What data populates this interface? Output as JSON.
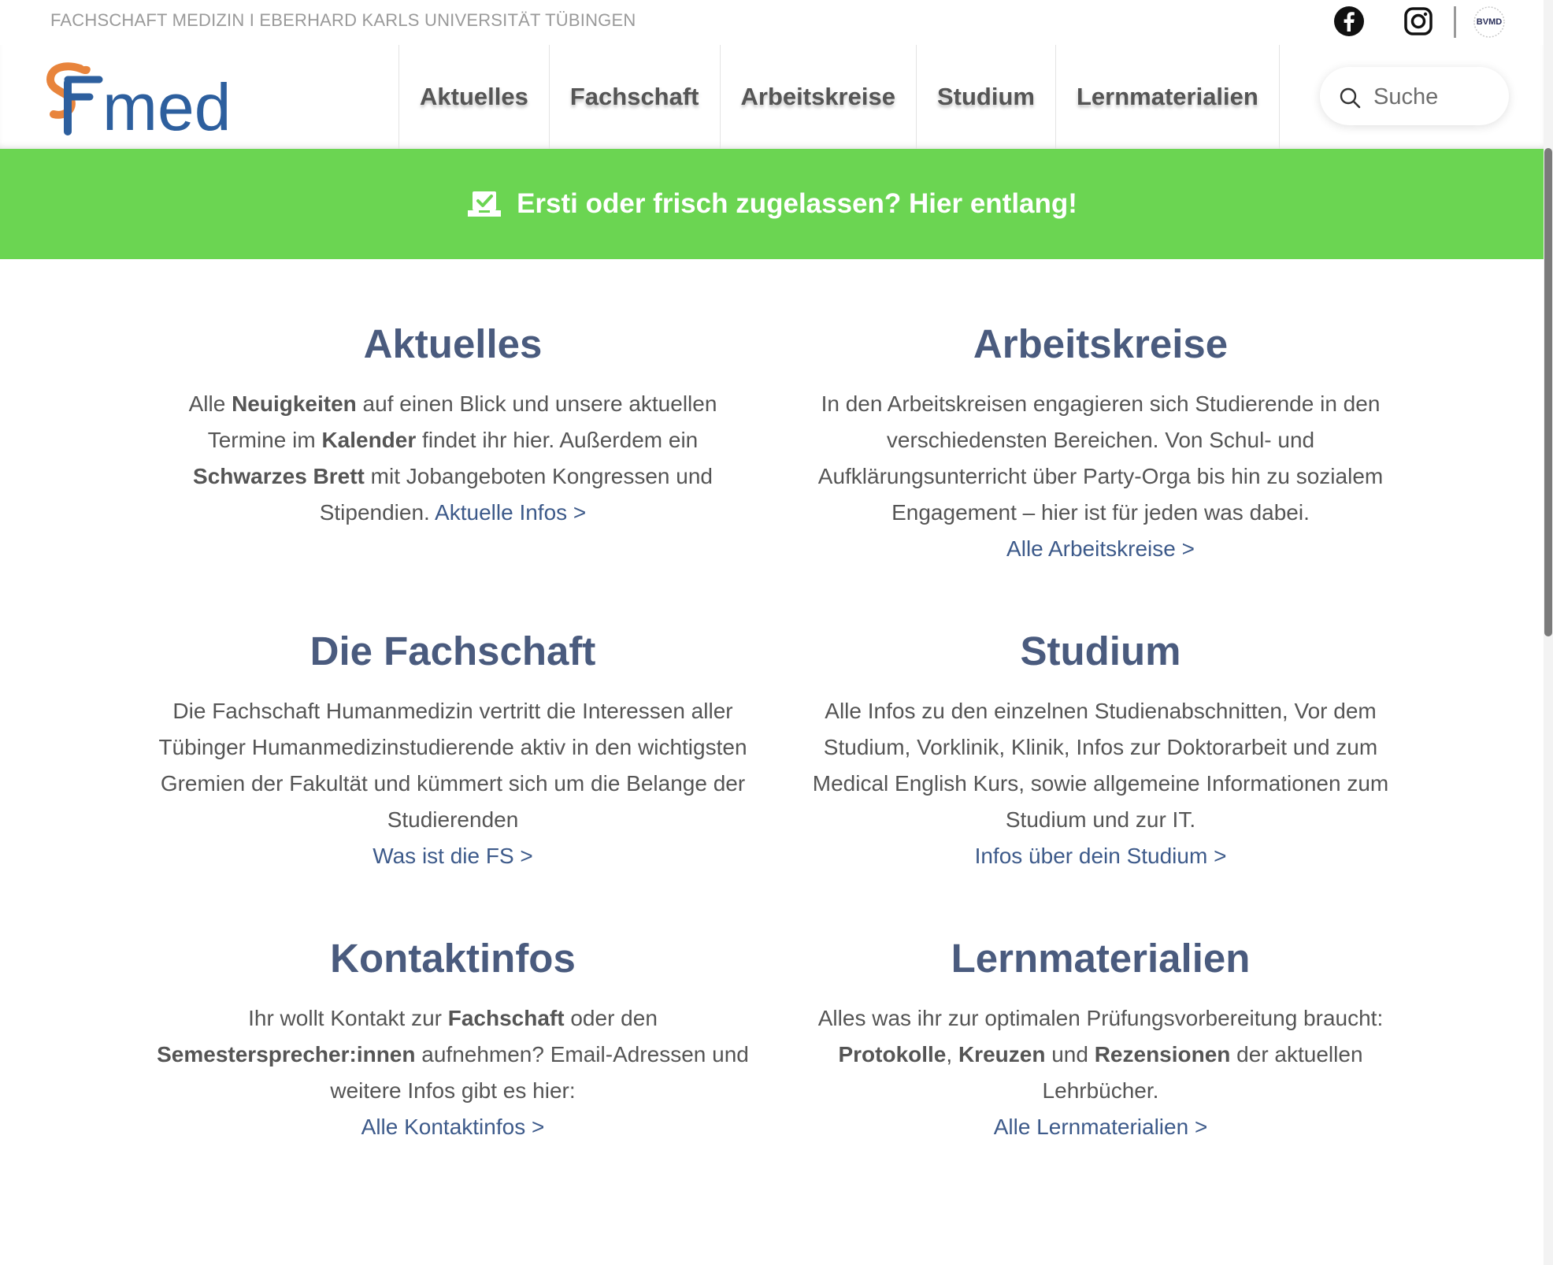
{
  "topbar": {
    "title": "FACHSCHAFT MEDIZIN I EBERHARD KARLS UNIVERSITÄT TÜBINGEN",
    "badge_text": "BVMD"
  },
  "header": {
    "logo_text": "med",
    "nav": [
      "Aktuelles",
      "Fachschaft",
      "Arbeitskreise",
      "Studium",
      "Lernmaterialien"
    ],
    "search_placeholder": "Suche"
  },
  "banner": {
    "text": "Ersti oder frisch zugelassen? Hier entlang!"
  },
  "cards": {
    "aktuelles": {
      "title": "Aktuelles",
      "t1": "Alle ",
      "b1": "Neuigkeiten",
      "t2": " auf einen Blick und unsere aktuellen Termine im ",
      "b2": "Kalender",
      "t3": " findet ihr hier. Außerdem ein ",
      "b3": "Schwarzes Brett",
      "t4": " mit Jobangeboten Kongressen und Stipendien. ",
      "link": "Aktuelle Infos >"
    },
    "arbeitskreise": {
      "title": "Arbeitskreise",
      "text": "In den Arbeitskreisen engagieren sich Studierende in den verschiedensten Bereichen. Von Schul- und Aufklärungsunterricht über Party-Orga bis hin zu sozialem Engagement – hier ist für jeden was dabei.",
      "link": "Alle Arbeitskreise >"
    },
    "fachschaft": {
      "title": "Die Fachschaft",
      "text": "Die Fachschaft Humanmedizin vertritt die Interessen aller Tübinger Humanmedizinstudierende aktiv in den wichtigsten Gremien der Fakultät und kümmert sich um die Belange der Studierenden",
      "link": "Was ist die FS >"
    },
    "studium": {
      "title": "Studium",
      "text": "Alle Infos zu den einzelnen Studienabschnitten, Vor dem Studium, Vorklinik, Klinik, Infos zur Doktorarbeit und zum Medical English Kurs, sowie allgemeine Informationen zum Studium und zur IT.",
      "link": "Infos über dein Studium >"
    },
    "kontakt": {
      "title": "Kontaktinfos",
      "t1": "Ihr wollt Kontakt zur ",
      "b1": "Fachschaft",
      "t2": " oder den ",
      "b2": "Semestersprecher:innen",
      "t3": " aufnehmen? Email-Adressen und weitere Infos gibt es hier:",
      "link": "Alle Kontaktinfos >"
    },
    "lernmaterialien": {
      "title": "Lernmaterialien",
      "t1": "Alles was ihr zur optimalen Prüfungsvorbereitung braucht: ",
      "b1": "Protokolle",
      "t2": ", ",
      "b2": "Kreuzen",
      "t3": " und ",
      "b3": "Rezensionen",
      "t4": " der aktuellen Lehrbücher.",
      "link": "Alle Lernmaterialien >"
    }
  },
  "colors": {
    "accent_green": "#6bd552",
    "heading_blue": "#4a5b7e",
    "link_blue": "#3d5a8a",
    "logo_orange": "#e8843c",
    "logo_blue": "#2d5f9e"
  }
}
